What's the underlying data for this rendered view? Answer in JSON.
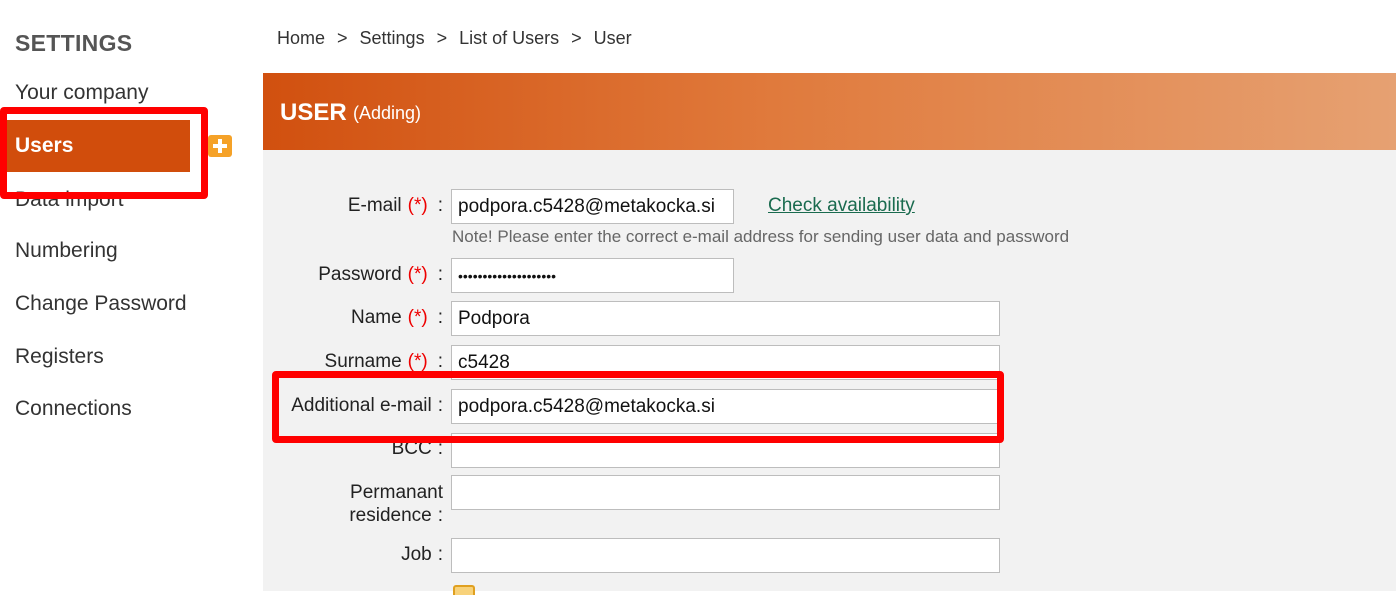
{
  "sidebar": {
    "title": "SETTINGS",
    "items": [
      {
        "label": "Your company"
      },
      {
        "label": "Users"
      },
      {
        "label": "Data import"
      },
      {
        "label": "Numbering"
      },
      {
        "label": "Change Password"
      },
      {
        "label": "Registers"
      },
      {
        "label": "Connections"
      }
    ]
  },
  "breadcrumb": {
    "items": [
      "Home",
      "Settings",
      "List of Users",
      "User"
    ],
    "separator": ">"
  },
  "header": {
    "title": "USER",
    "subtitle": "(Adding)"
  },
  "form": {
    "required_marker": "(*)",
    "colon": ":",
    "email": {
      "label": "E-mail",
      "value": "podpora.c5428@metakocka.si"
    },
    "check_availability": "Check availability",
    "note": "Note! Please enter the correct e-mail address for sending user data and password",
    "password": {
      "label": "Password",
      "value": "••••••••••••••••••••"
    },
    "name": {
      "label": "Name",
      "value": "Podpora"
    },
    "surname": {
      "label": "Surname",
      "value": "c5428"
    },
    "additional_email": {
      "label": "Additional e-mail",
      "value": "podpora.c5428@metakocka.si"
    },
    "bcc": {
      "label": "BCC",
      "value": ""
    },
    "permanent_residence": {
      "label_line1": "Permanant",
      "label_line2": "residence",
      "value": ""
    },
    "job": {
      "label": "Job",
      "value": ""
    }
  },
  "colors": {
    "accent": "#d14d0c",
    "highlight": "#ff0000",
    "link": "#1a6b4f",
    "required": "#ee0000"
  }
}
